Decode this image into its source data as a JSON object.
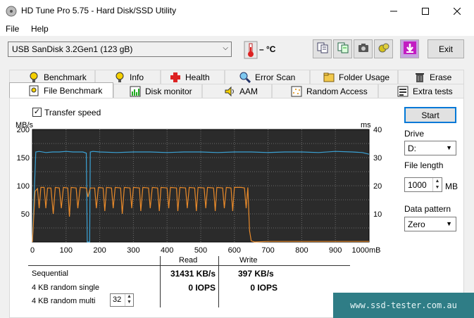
{
  "window": {
    "title": "HD Tune Pro 5.75 - Hard Disk/SSD Utility"
  },
  "menu": {
    "file": "File",
    "help": "Help"
  },
  "toolbar": {
    "drive": "USB SanDisk 3.2Gen1 (123 gB)",
    "temperature": "– °C",
    "exit_label": "Exit"
  },
  "tabs_row1": [
    "Benchmark",
    "Info",
    "Health",
    "Error Scan",
    "Folder Usage",
    "Erase"
  ],
  "tabs_row2": [
    "File Benchmark",
    "Disk monitor",
    "AAM",
    "Random Access",
    "Extra tests"
  ],
  "panel": {
    "transfer_speed_label": "Transfer speed",
    "start_label": "Start",
    "drive_label": "Drive",
    "drive_value": "D:",
    "file_length_label": "File length",
    "file_length_value": "1000",
    "file_length_unit": "MB",
    "pattern_label": "Data pattern",
    "pattern_value": "Zero"
  },
  "results": {
    "read_header": "Read",
    "write_header": "Write",
    "rows": [
      {
        "label": "Sequential",
        "read": "31431 KB/s",
        "write": "397 KB/s"
      },
      {
        "label": "4 KB random single",
        "read": "0 IOPS",
        "write": "0 IOPS"
      },
      {
        "label": "4 KB random multi",
        "read": "",
        "write": ""
      }
    ],
    "queue_depth": "32"
  },
  "watermark": "www.ssd-tester.com.au",
  "chart_data": {
    "type": "line",
    "ylabel": "MB/s",
    "y2label": "ms",
    "xlabel": "",
    "x_unit": "mB",
    "xlim": [
      0,
      1000
    ],
    "ylim": [
      0,
      200
    ],
    "y2lim": [
      0,
      40
    ],
    "x_ticks": [
      "0",
      "100",
      "200",
      "300",
      "400",
      "500",
      "600",
      "700",
      "800",
      "900",
      "1000mB"
    ],
    "y_ticks": [
      "50",
      "100",
      "150",
      "200"
    ],
    "y2_ticks": [
      "10",
      "20",
      "30",
      "40"
    ],
    "grid": true,
    "series": [
      {
        "color": "#3ba3d6",
        "points": [
          [
            0,
            0
          ],
          [
            10,
            160
          ],
          [
            20,
            161
          ],
          [
            40,
            159
          ],
          [
            60,
            160
          ],
          [
            80,
            160
          ],
          [
            100,
            161
          ],
          [
            120,
            160
          ],
          [
            150,
            160
          ],
          [
            160,
            158
          ],
          [
            163,
            0
          ],
          [
            170,
            0
          ],
          [
            172,
            160
          ],
          [
            180,
            161
          ],
          [
            200,
            160
          ],
          [
            250,
            159
          ],
          [
            300,
            160
          ],
          [
            350,
            160
          ],
          [
            400,
            159
          ],
          [
            450,
            160
          ],
          [
            500,
            160
          ],
          [
            550,
            159
          ],
          [
            600,
            160
          ],
          [
            650,
            160
          ],
          [
            700,
            159
          ],
          [
            750,
            160
          ],
          [
            800,
            160
          ],
          [
            850,
            159
          ],
          [
            900,
            161
          ],
          [
            950,
            160
          ],
          [
            980,
            159
          ],
          [
            1000,
            156
          ]
        ]
      },
      {
        "color": "#e98a2a",
        "points": [
          [
            0,
            0
          ],
          [
            8,
            90
          ],
          [
            15,
            95
          ],
          [
            20,
            60
          ],
          [
            25,
            97
          ],
          [
            35,
            97
          ],
          [
            40,
            60
          ],
          [
            45,
            96
          ],
          [
            55,
            96
          ],
          [
            62,
            50
          ],
          [
            68,
            97
          ],
          [
            80,
            96
          ],
          [
            86,
            60
          ],
          [
            92,
            97
          ],
          [
            105,
            96
          ],
          [
            110,
            45
          ],
          [
            115,
            97
          ],
          [
            130,
            96
          ],
          [
            135,
            60
          ],
          [
            142,
            97
          ],
          [
            160,
            96
          ],
          [
            165,
            80
          ],
          [
            172,
            96
          ],
          [
            185,
            96
          ],
          [
            190,
            60
          ],
          [
            196,
            97
          ],
          [
            210,
            96
          ],
          [
            215,
            55
          ],
          [
            220,
            97
          ],
          [
            235,
            96
          ],
          [
            240,
            60
          ],
          [
            246,
            97
          ],
          [
            262,
            96
          ],
          [
            267,
            50
          ],
          [
            273,
            97
          ],
          [
            290,
            96
          ],
          [
            295,
            60
          ],
          [
            300,
            97
          ],
          [
            318,
            96
          ],
          [
            322,
            55
          ],
          [
            328,
            97
          ],
          [
            345,
            96
          ],
          [
            350,
            60
          ],
          [
            356,
            97
          ],
          [
            372,
            96
          ],
          [
            377,
            55
          ],
          [
            382,
            97
          ],
          [
            400,
            96
          ],
          [
            405,
            60
          ],
          [
            410,
            97
          ],
          [
            428,
            96
          ],
          [
            432,
            55
          ],
          [
            438,
            97
          ],
          [
            455,
            96
          ],
          [
            460,
            60
          ],
          [
            466,
            97
          ],
          [
            482,
            96
          ],
          [
            487,
            55
          ],
          [
            492,
            97
          ],
          [
            510,
            96
          ],
          [
            515,
            60
          ],
          [
            520,
            97
          ],
          [
            538,
            96
          ],
          [
            543,
            55
          ],
          [
            548,
            97
          ],
          [
            565,
            96
          ],
          [
            570,
            60
          ],
          [
            576,
            97
          ],
          [
            590,
            96
          ],
          [
            595,
            55
          ],
          [
            600,
            97
          ],
          [
            620,
            97
          ],
          [
            630,
            96
          ],
          [
            635,
            60
          ],
          [
            640,
            97
          ],
          [
            645,
            20
          ],
          [
            650,
            2
          ],
          [
            660,
            0
          ],
          [
            700,
            1
          ],
          [
            800,
            1
          ],
          [
            900,
            1
          ],
          [
            1000,
            1
          ]
        ]
      }
    ]
  }
}
